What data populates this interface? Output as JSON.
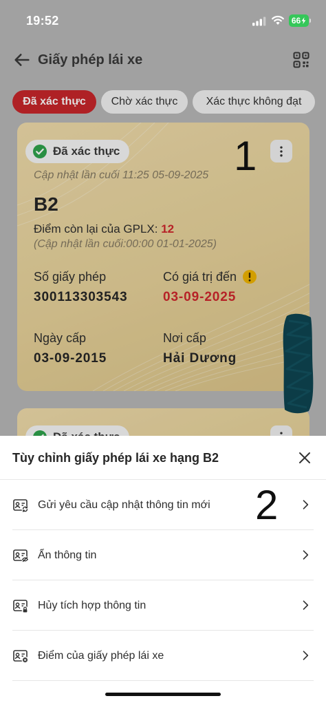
{
  "status_bar": {
    "time": "19:52",
    "battery": "66",
    "icons": [
      "cellular-signal-icon",
      "wifi-icon",
      "battery-charging-icon"
    ]
  },
  "header": {
    "title": "Giấy phép lái xe",
    "back_icon": "arrow-left-icon",
    "action_icon": "qr-code-icon"
  },
  "tabs": [
    {
      "label": "Đã xác thực",
      "selected": true
    },
    {
      "label": "Chờ xác thực",
      "selected": false
    },
    {
      "label": "Xác thực không đạt",
      "selected": false
    }
  ],
  "licenses": [
    {
      "status": "Đã xác thực",
      "status_icon": "check-circle-icon",
      "menu_icon": "more-vertical-icon",
      "last_updated": "Cập nhật lần cuối 11:25 05-09-2025",
      "class": "B2",
      "points_label": "Điểm còn lại của GPLX:",
      "points": "12",
      "points_updated": "(Cập nhật lần cuối:00:00 01-01-2025)",
      "license_number_label": "Số giấy phép",
      "license_number": "300113303543",
      "valid_until_label": "Có giá trị đến",
      "valid_until": "03-09-2025",
      "valid_until_icon": "warning-icon",
      "issue_date_label": "Ngày cấp",
      "issue_date": "03-09-2015",
      "issue_place_label": "Nơi cấp",
      "issue_place": "Hải Dương"
    },
    {
      "status": "Đã xác thực",
      "status_icon": "check-circle-icon",
      "menu_icon": "more-vertical-icon"
    }
  ],
  "annotations": {
    "card_marker": "1",
    "menu_marker": "2"
  },
  "sheet": {
    "title": "Tùy chỉnh giấy phép lái xe hạng B2",
    "close_icon": "close-icon",
    "items": [
      {
        "label": "Gửi yêu cầu cập nhật thông tin mới",
        "icon": "id-card-refresh-icon"
      },
      {
        "label": "Ẩn thông tin",
        "icon": "id-card-hide-icon"
      },
      {
        "label": "Hủy tích hợp thông tin",
        "icon": "id-card-lock-icon"
      },
      {
        "label": "Điểm của giấy phép lái xe",
        "icon": "id-card-points-icon"
      }
    ]
  },
  "colors": {
    "primary_red": "#c8262b",
    "value_red": "#d0272d",
    "verified_green": "#2fa34d",
    "warning_yellow": "#f0b400",
    "battery_green": "#35c759",
    "redaction_teal": "#0c3c47"
  }
}
